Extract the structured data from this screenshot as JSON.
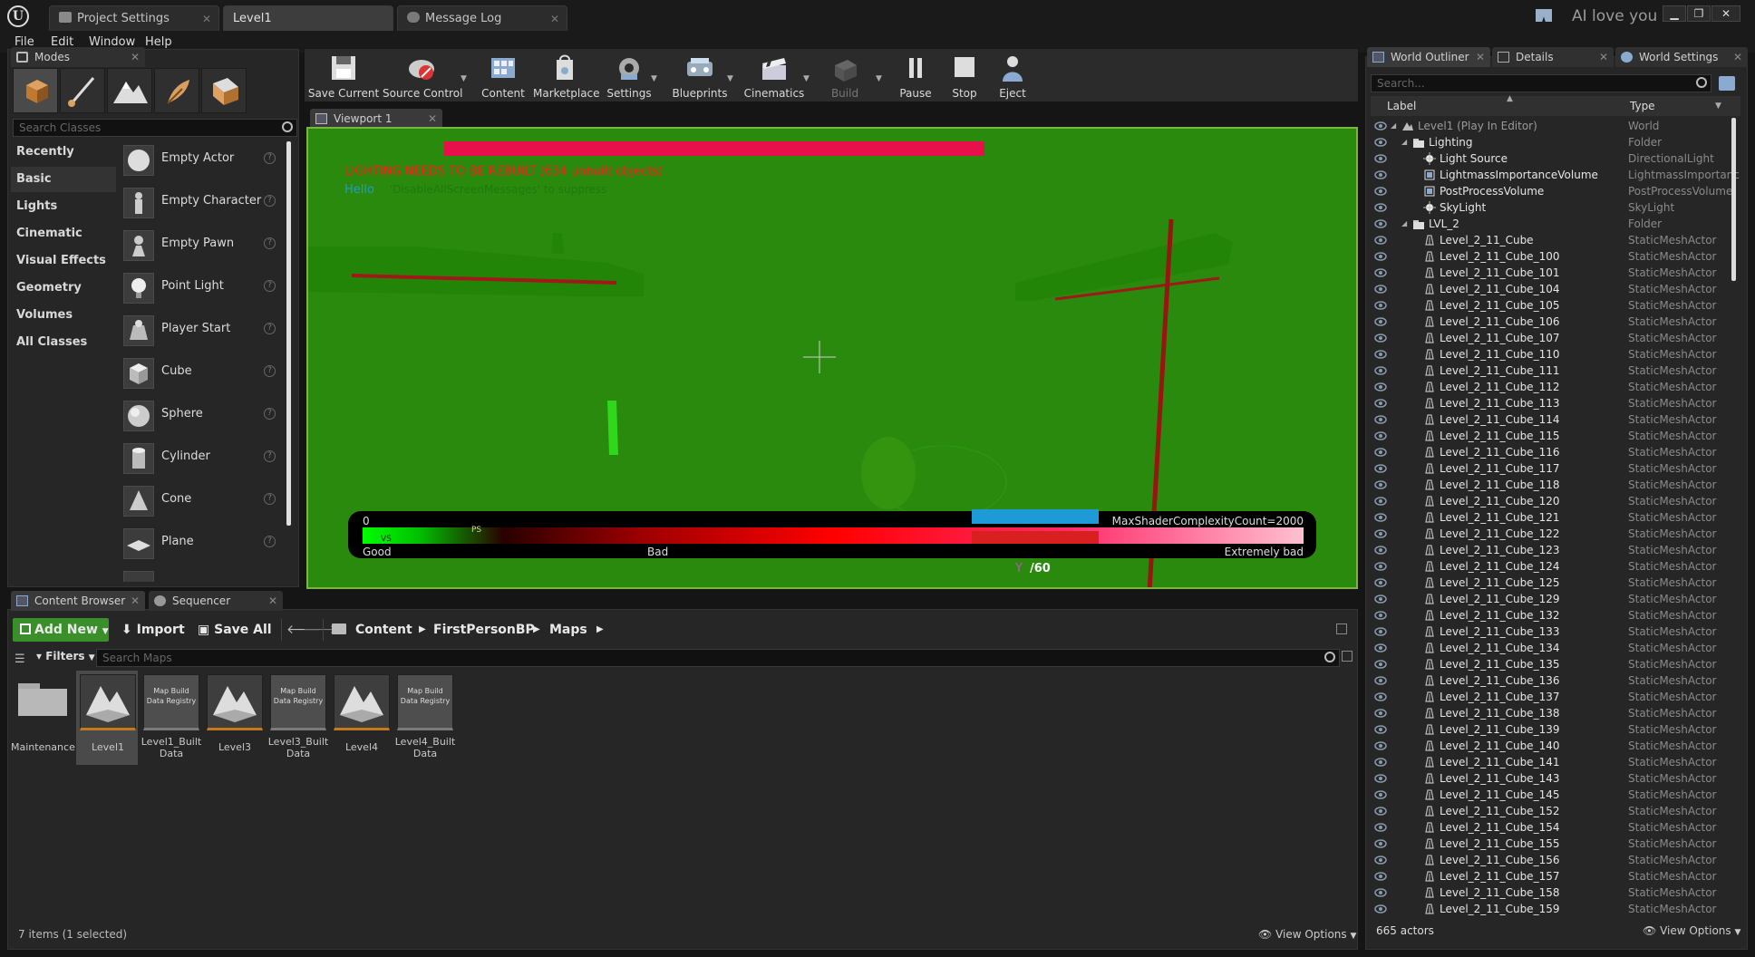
{
  "titlebar": {
    "tabs": [
      {
        "label": "Project Settings"
      },
      {
        "label": "Level1"
      },
      {
        "label": "Message Log"
      }
    ],
    "user_text": "AI love you",
    "window_buttons": [
      "minimize-icon",
      "restore-icon",
      "close-icon"
    ]
  },
  "menu": [
    "File",
    "Edit",
    "Window",
    "Help"
  ],
  "modes": {
    "tab_label": "Modes",
    "search_placeholder": "Search Classes",
    "categories": [
      "Recently Placed",
      "Basic",
      "Lights",
      "Cinematic",
      "Visual Effects",
      "Geometry",
      "Volumes",
      "All Classes"
    ],
    "selected_category": "Basic",
    "items": [
      {
        "label": "Empty Actor",
        "icon": "empty-actor-icon"
      },
      {
        "label": "Empty Character",
        "icon": "character-icon"
      },
      {
        "label": "Empty Pawn",
        "icon": "pawn-icon"
      },
      {
        "label": "Point Light",
        "icon": "point-light-icon"
      },
      {
        "label": "Player Start",
        "icon": "player-start-icon"
      },
      {
        "label": "Cube",
        "icon": "cube-icon"
      },
      {
        "label": "Sphere",
        "icon": "sphere-icon"
      },
      {
        "label": "Cylinder",
        "icon": "cylinder-icon"
      },
      {
        "label": "Cone",
        "icon": "cone-icon"
      },
      {
        "label": "Plane",
        "icon": "plane-icon"
      }
    ]
  },
  "toolbar": [
    {
      "label": "Save Current",
      "icon": "save-icon"
    },
    {
      "label": "Source Control",
      "icon": "source-control-icon"
    },
    {
      "label": "Content",
      "icon": "content-icon"
    },
    {
      "label": "Marketplace",
      "icon": "marketplace-icon"
    },
    {
      "label": "Settings",
      "icon": "settings-icon"
    },
    {
      "label": "Blueprints",
      "icon": "blueprints-icon"
    },
    {
      "label": "Cinematics",
      "icon": "cinematics-icon"
    },
    {
      "label": "Build",
      "icon": "build-icon"
    },
    {
      "label": "Pause",
      "icon": "pause-icon"
    },
    {
      "label": "Stop",
      "icon": "stop-icon"
    },
    {
      "label": "Eject",
      "icon": "eject-icon"
    }
  ],
  "viewport": {
    "tab_label": "Viewport 1",
    "warning": "LIGHTING NEEDS TO BE REBUILT (634 unbuilt objects)",
    "hello": "Hello",
    "suppress_hint": "'DisableAllScreenMessages' to suppress",
    "shader_complexity": {
      "min_label": "0",
      "max_label": "MaxShaderComplexityCount=2000",
      "good_label": "Good",
      "bad_label": "Bad",
      "extremely_bad_label": "Extremely bad",
      "ps_label": "PS",
      "vs_label": "VS",
      "fps_suffix": "/60"
    }
  },
  "content_browser": {
    "tabs": [
      {
        "label": "Content Browser"
      },
      {
        "label": "Sequencer"
      }
    ],
    "add_new": "Add New",
    "import": "Import",
    "save_all": "Save All",
    "path": [
      "Content",
      "FirstPersonBP",
      "Maps"
    ],
    "filters": "Filters",
    "search_placeholder": "Search Maps",
    "assets": [
      {
        "label": "Maintenance",
        "kind": "folder"
      },
      {
        "label": "Level1",
        "kind": "map",
        "selected": true
      },
      {
        "label": "Level1_Built Data",
        "kind": "registry"
      },
      {
        "label": "Level3",
        "kind": "map"
      },
      {
        "label": "Level3_Built Data",
        "kind": "registry"
      },
      {
        "label": "Level4",
        "kind": "map"
      },
      {
        "label": "Level4_Built Data",
        "kind": "registry"
      }
    ],
    "registry_text": "Map Build Data Registry",
    "status": "7 items (1 selected)",
    "view_options": "View Options"
  },
  "outliner": {
    "tabs": [
      {
        "label": "World Outliner"
      },
      {
        "label": "Details"
      },
      {
        "label": "World Settings"
      }
    ],
    "search_placeholder": "Search...",
    "col_label": "Label",
    "col_type": "Type",
    "rows": [
      {
        "label": "Level1 (Play In Editor)",
        "type": "World",
        "indent": 0,
        "kind": "world"
      },
      {
        "label": "Lighting",
        "type": "Folder",
        "indent": 1,
        "kind": "folder"
      },
      {
        "label": "Light Source",
        "type": "DirectionalLight",
        "indent": 2,
        "kind": "light"
      },
      {
        "label": "LightmassImportanceVolume",
        "type": "LightmassImportanc",
        "indent": 2,
        "kind": "volume"
      },
      {
        "label": "PostProcessVolume",
        "type": "PostProcessVolume",
        "indent": 2,
        "kind": "volume"
      },
      {
        "label": "SkyLight",
        "type": "SkyLight",
        "indent": 2,
        "kind": "light"
      },
      {
        "label": "LVL_2",
        "type": "Folder",
        "indent": 1,
        "kind": "folder"
      },
      {
        "label": "Level_2_11_Cube",
        "type": "StaticMeshActor",
        "indent": 2,
        "kind": "mesh"
      },
      {
        "label": "Level_2_11_Cube_100",
        "type": "StaticMeshActor",
        "indent": 2,
        "kind": "mesh"
      },
      {
        "label": "Level_2_11_Cube_101",
        "type": "StaticMeshActor",
        "indent": 2,
        "kind": "mesh"
      },
      {
        "label": "Level_2_11_Cube_104",
        "type": "StaticMeshActor",
        "indent": 2,
        "kind": "mesh"
      },
      {
        "label": "Level_2_11_Cube_105",
        "type": "StaticMeshActor",
        "indent": 2,
        "kind": "mesh"
      },
      {
        "label": "Level_2_11_Cube_106",
        "type": "StaticMeshActor",
        "indent": 2,
        "kind": "mesh"
      },
      {
        "label": "Level_2_11_Cube_107",
        "type": "StaticMeshActor",
        "indent": 2,
        "kind": "mesh"
      },
      {
        "label": "Level_2_11_Cube_110",
        "type": "StaticMeshActor",
        "indent": 2,
        "kind": "mesh"
      },
      {
        "label": "Level_2_11_Cube_111",
        "type": "StaticMeshActor",
        "indent": 2,
        "kind": "mesh"
      },
      {
        "label": "Level_2_11_Cube_112",
        "type": "StaticMeshActor",
        "indent": 2,
        "kind": "mesh"
      },
      {
        "label": "Level_2_11_Cube_113",
        "type": "StaticMeshActor",
        "indent": 2,
        "kind": "mesh"
      },
      {
        "label": "Level_2_11_Cube_114",
        "type": "StaticMeshActor",
        "indent": 2,
        "kind": "mesh"
      },
      {
        "label": "Level_2_11_Cube_115",
        "type": "StaticMeshActor",
        "indent": 2,
        "kind": "mesh"
      },
      {
        "label": "Level_2_11_Cube_116",
        "type": "StaticMeshActor",
        "indent": 2,
        "kind": "mesh"
      },
      {
        "label": "Level_2_11_Cube_117",
        "type": "StaticMeshActor",
        "indent": 2,
        "kind": "mesh"
      },
      {
        "label": "Level_2_11_Cube_118",
        "type": "StaticMeshActor",
        "indent": 2,
        "kind": "mesh"
      },
      {
        "label": "Level_2_11_Cube_120",
        "type": "StaticMeshActor",
        "indent": 2,
        "kind": "mesh"
      },
      {
        "label": "Level_2_11_Cube_121",
        "type": "StaticMeshActor",
        "indent": 2,
        "kind": "mesh"
      },
      {
        "label": "Level_2_11_Cube_122",
        "type": "StaticMeshActor",
        "indent": 2,
        "kind": "mesh"
      },
      {
        "label": "Level_2_11_Cube_123",
        "type": "StaticMeshActor",
        "indent": 2,
        "kind": "mesh"
      },
      {
        "label": "Level_2_11_Cube_124",
        "type": "StaticMeshActor",
        "indent": 2,
        "kind": "mesh"
      },
      {
        "label": "Level_2_11_Cube_125",
        "type": "StaticMeshActor",
        "indent": 2,
        "kind": "mesh"
      },
      {
        "label": "Level_2_11_Cube_129",
        "type": "StaticMeshActor",
        "indent": 2,
        "kind": "mesh"
      },
      {
        "label": "Level_2_11_Cube_132",
        "type": "StaticMeshActor",
        "indent": 2,
        "kind": "mesh"
      },
      {
        "label": "Level_2_11_Cube_133",
        "type": "StaticMeshActor",
        "indent": 2,
        "kind": "mesh"
      },
      {
        "label": "Level_2_11_Cube_134",
        "type": "StaticMeshActor",
        "indent": 2,
        "kind": "mesh"
      },
      {
        "label": "Level_2_11_Cube_135",
        "type": "StaticMeshActor",
        "indent": 2,
        "kind": "mesh"
      },
      {
        "label": "Level_2_11_Cube_136",
        "type": "StaticMeshActor",
        "indent": 2,
        "kind": "mesh"
      },
      {
        "label": "Level_2_11_Cube_137",
        "type": "StaticMeshActor",
        "indent": 2,
        "kind": "mesh"
      },
      {
        "label": "Level_2_11_Cube_138",
        "type": "StaticMeshActor",
        "indent": 2,
        "kind": "mesh"
      },
      {
        "label": "Level_2_11_Cube_139",
        "type": "StaticMeshActor",
        "indent": 2,
        "kind": "mesh"
      },
      {
        "label": "Level_2_11_Cube_140",
        "type": "StaticMeshActor",
        "indent": 2,
        "kind": "mesh"
      },
      {
        "label": "Level_2_11_Cube_141",
        "type": "StaticMeshActor",
        "indent": 2,
        "kind": "mesh"
      },
      {
        "label": "Level_2_11_Cube_143",
        "type": "StaticMeshActor",
        "indent": 2,
        "kind": "mesh"
      },
      {
        "label": "Level_2_11_Cube_145",
        "type": "StaticMeshActor",
        "indent": 2,
        "kind": "mesh"
      },
      {
        "label": "Level_2_11_Cube_152",
        "type": "StaticMeshActor",
        "indent": 2,
        "kind": "mesh"
      },
      {
        "label": "Level_2_11_Cube_154",
        "type": "StaticMeshActor",
        "indent": 2,
        "kind": "mesh"
      },
      {
        "label": "Level_2_11_Cube_155",
        "type": "StaticMeshActor",
        "indent": 2,
        "kind": "mesh"
      },
      {
        "label": "Level_2_11_Cube_156",
        "type": "StaticMeshActor",
        "indent": 2,
        "kind": "mesh"
      },
      {
        "label": "Level_2_11_Cube_157",
        "type": "StaticMeshActor",
        "indent": 2,
        "kind": "mesh"
      },
      {
        "label": "Level_2_11_Cube_158",
        "type": "StaticMeshActor",
        "indent": 2,
        "kind": "mesh"
      },
      {
        "label": "Level_2_11_Cube_159",
        "type": "StaticMeshActor",
        "indent": 2,
        "kind": "mesh"
      }
    ],
    "actor_count": "665 actors",
    "view_options": "View Options"
  },
  "colors": {
    "viewport_green": "#2a8a0d",
    "warning_red": "#e8104a",
    "hello_blue": "#1e9bd7",
    "add_new_green": "#3a8f2a"
  }
}
